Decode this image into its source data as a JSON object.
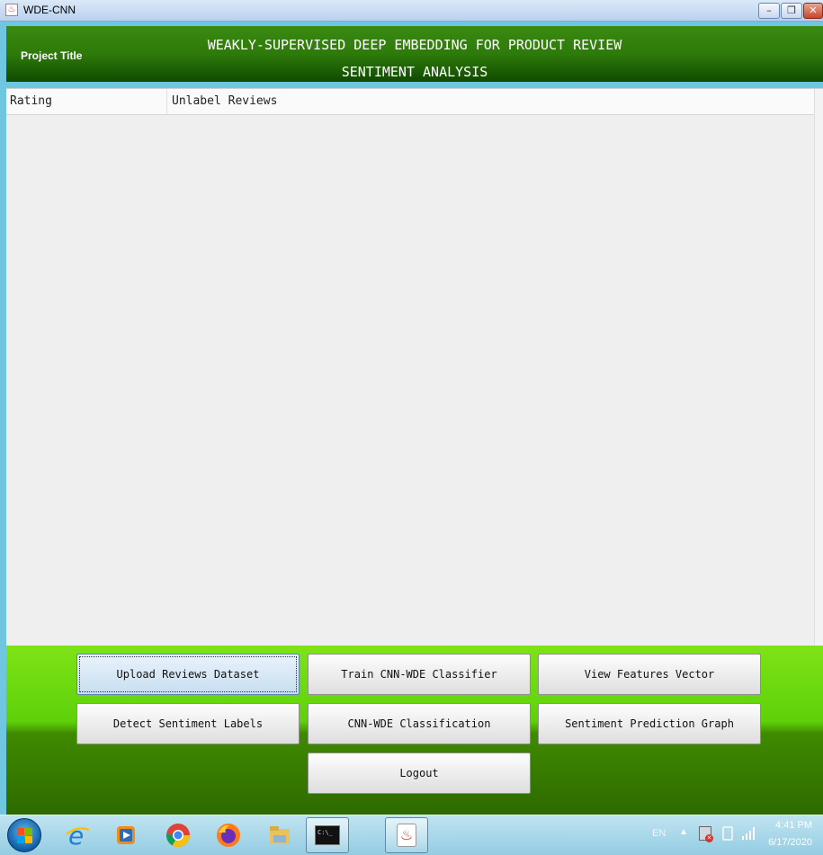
{
  "window": {
    "title": "WDE-CNN",
    "minimize_glyph": "–",
    "maximize_glyph": "❐",
    "close_glyph": "✕"
  },
  "header": {
    "project_label": "Project Title",
    "title_line1": "WEAKLY-SUPERVISED DEEP EMBEDDING FOR PRODUCT REVIEW",
    "title_line2": "SENTIMENT ANALYSIS"
  },
  "table": {
    "columns": [
      "Rating",
      "Unlabel Reviews"
    ]
  },
  "buttons": {
    "upload": "Upload Reviews Dataset",
    "train": "Train CNN-WDE Classifier",
    "view_features": "View Features Vector",
    "detect": "Detect Sentiment Labels",
    "classify": "CNN-WDE Classification",
    "graph": "Sentiment Prediction Graph",
    "logout": "Logout"
  },
  "taskbar": {
    "cmd_label": "C:\\_",
    "language": "EN",
    "time": "4:41 PM",
    "date": "6/17/2020",
    "icons": [
      "start-orb-icon",
      "internet-explorer-icon",
      "media-player-icon",
      "chrome-icon",
      "firefox-icon",
      "file-explorer-icon",
      "command-prompt-icon",
      "java-icon"
    ]
  }
}
